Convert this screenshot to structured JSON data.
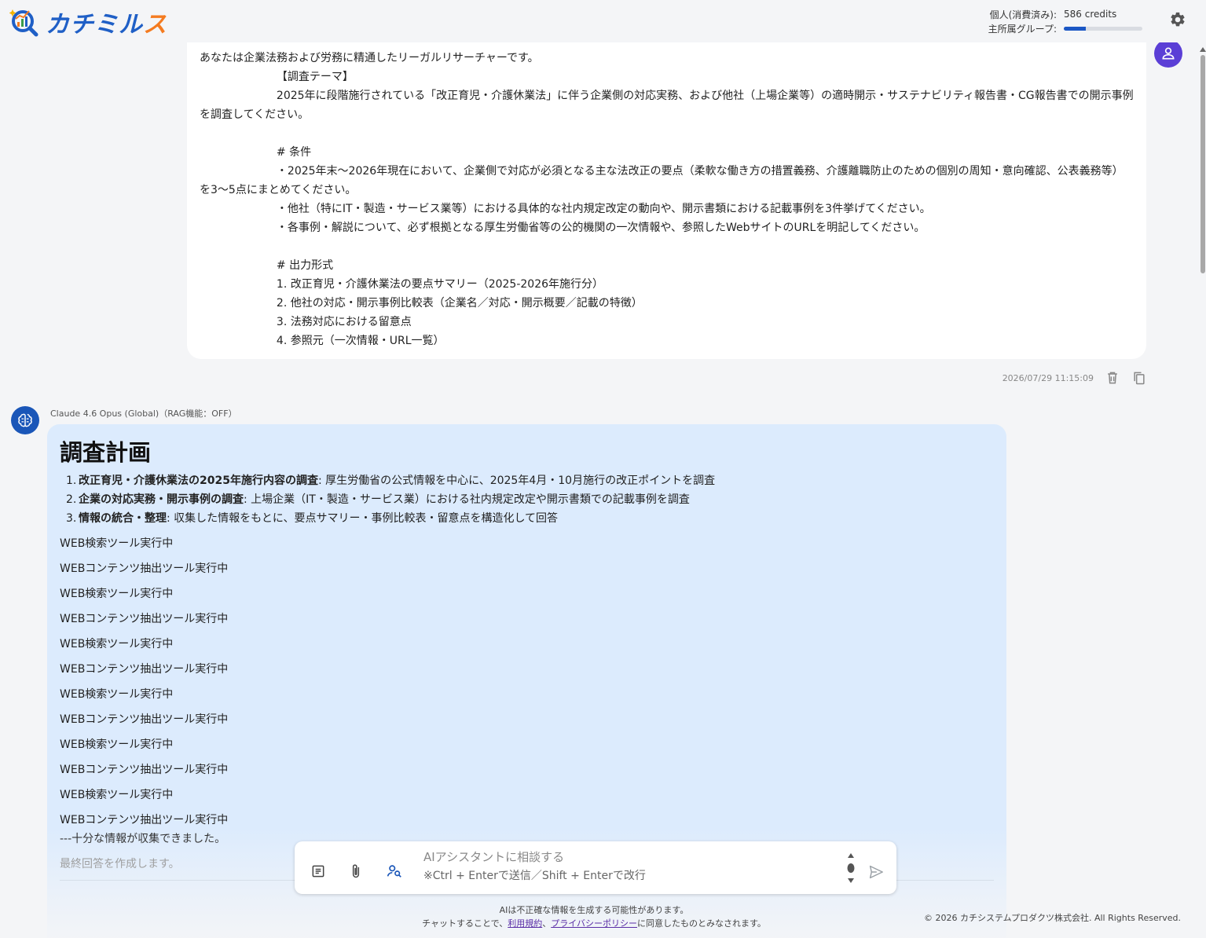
{
  "header": {
    "logo_text_main": "カチミル",
    "logo_text_accent": "ス",
    "credits": {
      "personal_label": "個人(消費済み):",
      "personal_value": "586 credits",
      "group_label": "主所属グループ:",
      "group_usage_fraction": 0.28
    },
    "settings_icon": "gear-icon"
  },
  "user_message": {
    "text": "あなたは企業法務および労務に精通したリーガルリサーチャーです。\n                      【調査テーマ】\n                      2025年に段階施行されている「改正育児・介護休業法」に伴う企業側の対応実務、および他社（上場企業等）の適時開示・サステナビリティ報告書・CG報告書での開示事例を調査してください。\n\n                      # 条件\n                      ・2025年末〜2026年現在において、企業側で対応が必須となる主な法改正の要点（柔軟な働き方の措置義務、介護離職防止のための個別の周知・意向確認、公表義務等）を3〜5点にまとめてください。\n                      ・他社（特にIT・製造・サービス業等）における具体的な社内規定改定の動向や、開示書類における記載事例を3件挙げてください。\n                      ・各事例・解説について、必ず根拠となる厚生労働省等の公的機関の一次情報や、参照したWebサイトのURLを明記してください。\n\n                      # 出力形式\n                      1. 改正育児・介護休業法の要点サマリー（2025-2026年施行分）\n                      2. 他社の対応・開示事例比較表（企業名／対応・開示概要／記載の特徴）\n                      3. 法務対応における留意点\n                      4. 参照元（一次情報・URL一覧）",
    "timestamp": "2026/07/29 11:15:09",
    "avatar_icon": "user-icon",
    "delete_icon": "trash-icon",
    "copy_icon": "copy-icon"
  },
  "assistant": {
    "model_label": "Claude 4.6 Opus (Global)（RAG機能：OFF）",
    "avatar_icon": "brain-icon",
    "title": "調査計画",
    "plan": [
      {
        "num": "1.",
        "bold": "改正育児・介護休業法の2025年施行内容の調査",
        "text": ": 厚生労働省の公式情報を中心に、2025年4月・10月施行の改正ポイントを調査"
      },
      {
        "num": "2.",
        "bold": "企業の対応実務・開示事例の調査",
        "text": ": 上場企業（IT・製造・サービス業）における社内規定改定や開示書類での記載事例を調査"
      },
      {
        "num": "3.",
        "bold": "情報の統合・整理",
        "text": ": 収集した情報をもとに、要点サマリー・事例比較表・留意点を構造化して回答"
      }
    ],
    "tool_lines": [
      "WEB検索ツール実行中",
      "WEBコンテンツ抽出ツール実行中",
      "WEB検索ツール実行中",
      "WEBコンテンツ抽出ツール実行中",
      "WEB検索ツール実行中",
      "WEBコンテンツ抽出ツール実行中",
      "WEB検索ツール実行中",
      "WEBコンテンツ抽出ツール実行中",
      "WEB検索ツール実行中",
      "WEBコンテンツ抽出ツール実行中",
      "WEB検索ツール実行中",
      "WEBコンテンツ抽出ツール実行中"
    ],
    "collected": "---十分な情報が収集できました。",
    "final": "最終回答を作成します。"
  },
  "composer": {
    "placeholder": "AIアシスタントに相談する",
    "hint": "※Ctrl + Enterで送信／Shift + Enterで改行",
    "icons": [
      "document-icon",
      "paperclip-icon",
      "person-search-icon",
      "send-icon"
    ]
  },
  "footer": {
    "line1": "AIは不正確な情報を生成する可能性があります。",
    "line2_prefix": "チャットすることで、",
    "terms_link": "利用規約",
    "separator": "、",
    "privacy_link": "プライバシーポリシー",
    "line2_suffix": "に同意したものとみなされます。",
    "copyright": "© 2026 カチシステムプロダクツ株式会社. All Rights Reserved."
  },
  "colors": {
    "brand_blue": "#1f5fc6",
    "brand_orange": "#f47b20",
    "user_avatar": "#5b3fd6",
    "ai_bubble": "#dcebfd",
    "link": "#5a2ea6"
  }
}
